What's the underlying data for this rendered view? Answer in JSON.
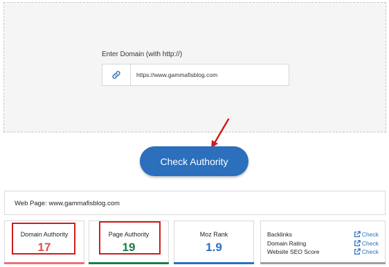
{
  "form": {
    "label": "Enter Domain (with http://)",
    "link_icon": "link-icon",
    "domain_value": "https://www.gammafisblog.com",
    "check_button": "Check Authority"
  },
  "result": {
    "webpage_label": "Web Page: www.gammafisblog.com",
    "domain_authority": {
      "label": "Domain Authority",
      "value": "17",
      "color": "#d9534f"
    },
    "page_authority": {
      "label": "Page Authority",
      "value": "19",
      "color": "#1e7b45"
    },
    "moz_rank": {
      "label": "Moz Rank",
      "value": "1.9",
      "color": "#2b6fbd"
    },
    "links": [
      {
        "label": "Backlinks",
        "action": "Check"
      },
      {
        "label": "Domain Rating",
        "action": "Check"
      },
      {
        "label": "Website SEO Score",
        "action": "Check"
      }
    ]
  },
  "colors": {
    "accent": "#2b6fbd",
    "highlight": "#d01c1c",
    "annotation_arrow": "#d01c1c"
  }
}
